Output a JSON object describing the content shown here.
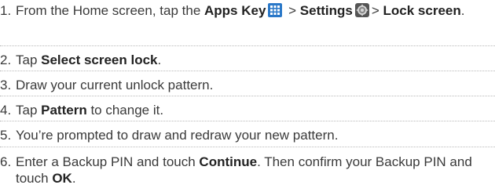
{
  "steps": [
    {
      "number": "1.",
      "t1": "From the Home screen, tap the ",
      "apps_key": "Apps Key",
      "t2": " > ",
      "settings": "Settings",
      "t3": "> ",
      "lock_screen": "Lock screen",
      "t4": "."
    },
    {
      "number": "2.",
      "t1": "Tap ",
      "select_screen_lock": "Select screen lock",
      "t2": "."
    },
    {
      "number": "3.",
      "text": "Draw your current unlock pattern."
    },
    {
      "number": "4.",
      "t1": "Tap ",
      "pattern": "Pattern",
      "t2": " to change it."
    },
    {
      "number": "5.",
      "text": "You’re prompted to draw and redraw your new pattern."
    },
    {
      "number": "6.",
      "t1": "Enter a Backup PIN and touch ",
      "continue": "Continue",
      "t2": ". Then confirm your Backup PIN and touch ",
      "ok": "OK",
      "t3": "."
    }
  ],
  "icons": {
    "apps_key": "apps-grid-icon",
    "settings": "settings-gear-icon"
  },
  "colors": {
    "text": "#3a3a3a",
    "emphasis": "#222222",
    "divider": "#b9b9b9",
    "apps_icon": "#2a78c8"
  }
}
